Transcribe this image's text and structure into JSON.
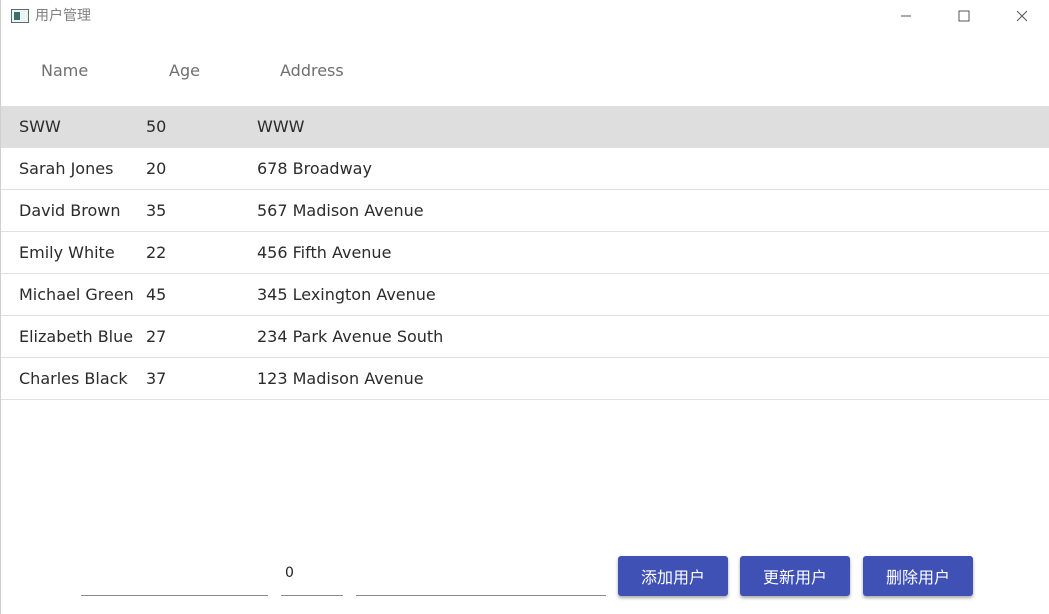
{
  "window": {
    "title": "用户管理",
    "icon": "app-window-icon",
    "controls": [
      "minimize-icon",
      "maximize-icon",
      "close-icon"
    ]
  },
  "table": {
    "columns": [
      "Name",
      "Age",
      "Address"
    ],
    "rows": [
      {
        "name": "SWW",
        "age": "50",
        "address": "WWW",
        "selected": true
      },
      {
        "name": "Sarah Jones",
        "age": "20",
        "address": "678 Broadway"
      },
      {
        "name": "David Brown",
        "age": "35",
        "address": "567 Madison Avenue"
      },
      {
        "name": "Emily White",
        "age": "22",
        "address": "456 Fifth Avenue"
      },
      {
        "name": "Michael Green",
        "age": "45",
        "address": "345 Lexington Avenue"
      },
      {
        "name": "Elizabeth Blue",
        "age": "27",
        "address": "234 Park Avenue South"
      },
      {
        "name": "Charles Black",
        "age": "37",
        "address": "123 Madison Avenue"
      }
    ]
  },
  "form": {
    "name_value": "",
    "age_value": "0",
    "address_value": ""
  },
  "actions": {
    "add_label": "添加用户",
    "update_label": "更新用户",
    "delete_label": "删除用户"
  },
  "colors": {
    "accent": "#3f51b5",
    "selected_row": "#dedede"
  }
}
